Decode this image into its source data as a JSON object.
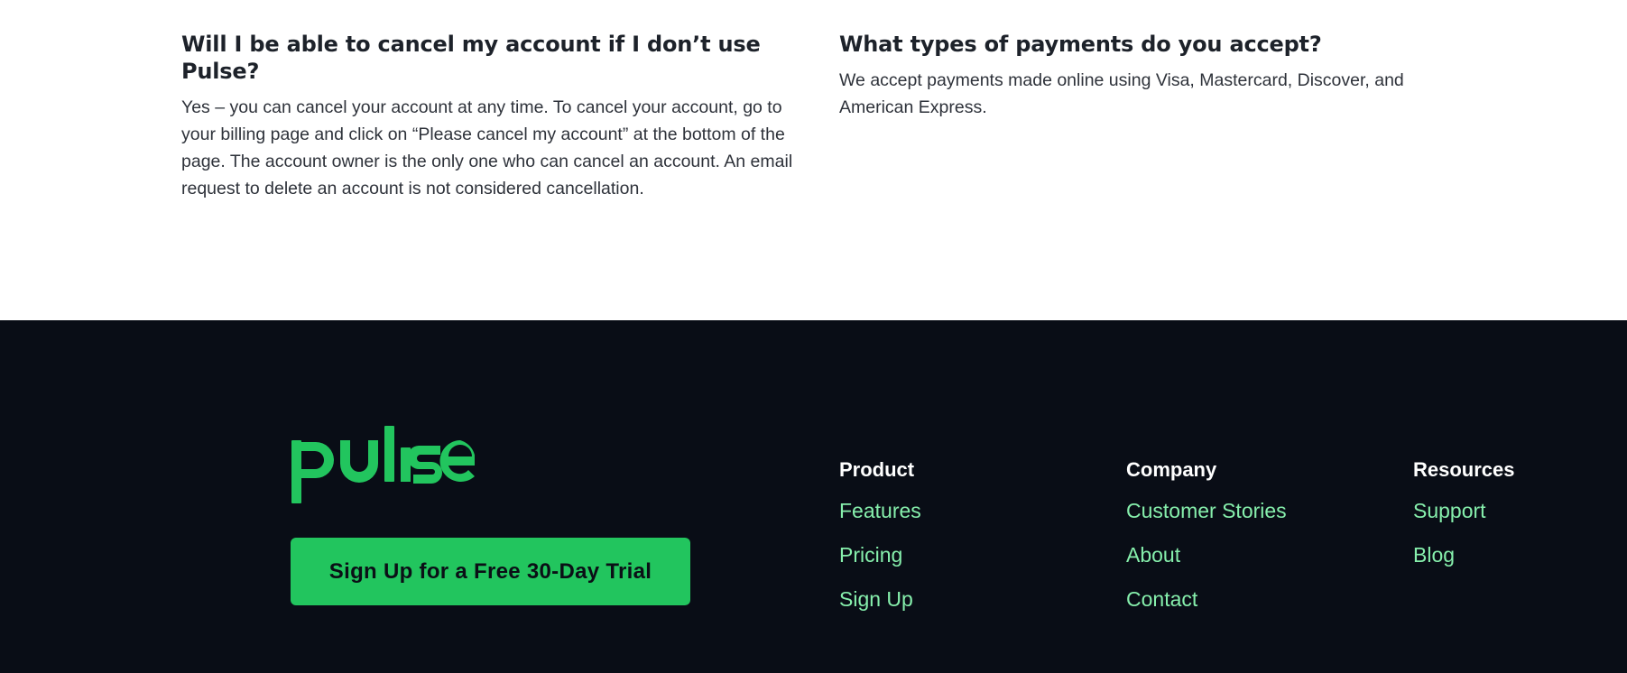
{
  "faq": [
    {
      "question": "Will I be able to cancel my account if I don’t use Pulse?",
      "answer": "Yes – you can cancel your account at any time. To cancel your account, go to your billing page and click on “Please cancel my account” at the bottom of the page. The account owner is the only one who can cancel an account. An email request to delete an account is not considered cancellation."
    },
    {
      "question": "What types of payments do you accept?",
      "answer": "We accept payments made online using Visa, Mastercard, Discover, and American Express."
    }
  ],
  "footer": {
    "logo_text": "pulse",
    "brand_color": "#22c55e",
    "cta_label": "Sign Up for a Free 30-Day Trial",
    "columns": [
      {
        "heading": "Product",
        "links": [
          "Features",
          "Pricing",
          "Sign Up"
        ]
      },
      {
        "heading": "Company",
        "links": [
          "Customer Stories",
          "About",
          "Contact"
        ]
      },
      {
        "heading": "Resources",
        "links": [
          "Support",
          "Blog"
        ]
      }
    ]
  }
}
